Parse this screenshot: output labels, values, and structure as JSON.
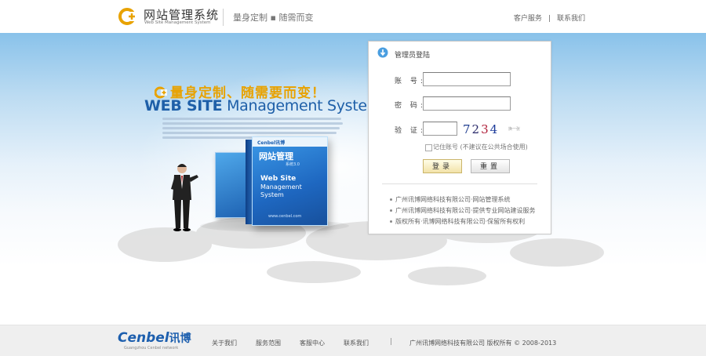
{
  "header": {
    "logo_title": "网站管理系统",
    "logo_subtitle": "Web Site Management System",
    "slogan": "量身定制 ▪ 随需而变",
    "links": [
      "客户服务",
      "联系我们"
    ],
    "link_separator": "|"
  },
  "hero": {
    "title": "量身定制、随需要而变！",
    "subtitle_bold": "WEB SITE",
    "subtitle_thin": " Management System",
    "box": {
      "brand": "Cenbel讯博",
      "cn_title": "网站管理",
      "cn_version": "系统3.0",
      "en_line1": "Web Site",
      "en_line2": "Management",
      "en_line3": "System",
      "url": "www.cenbel.com"
    }
  },
  "login": {
    "title": "管理员登陆",
    "account_label": "账 号:",
    "password_label": "密 码:",
    "captcha_label": "验 证:",
    "account_value": "",
    "password_value": "",
    "captcha_value": "",
    "captcha_chars": [
      "7",
      "2",
      "3",
      "4"
    ],
    "captcha_swap": "换一张",
    "remember_label": "记住账号 (不建议在公共场合使用)",
    "remember_checked": false,
    "login_button": "登录",
    "reset_button": "重置",
    "notices": [
      "广州讯博网络科技有限公司·网站管理系统",
      "广州讯博网络科技有限公司·提供专业网站建设服务",
      "版权所有·讯博网络科技有限公司·保留所有权利"
    ]
  },
  "footer": {
    "logo_en": "Cenbel",
    "logo_cn": "讯博",
    "logo_sub": "Guangzhou Cenbel network",
    "links": [
      "关于我们",
      "服务范围",
      "客服中心",
      "联系我们"
    ],
    "separator": "|",
    "copyright": "广州讯博网络科技有限公司 版权所有 © 2008-2013"
  },
  "colors": {
    "brand_blue": "#1e5fa8",
    "brand_gold": "#e8a200",
    "sky_top": "#89c2ea"
  }
}
